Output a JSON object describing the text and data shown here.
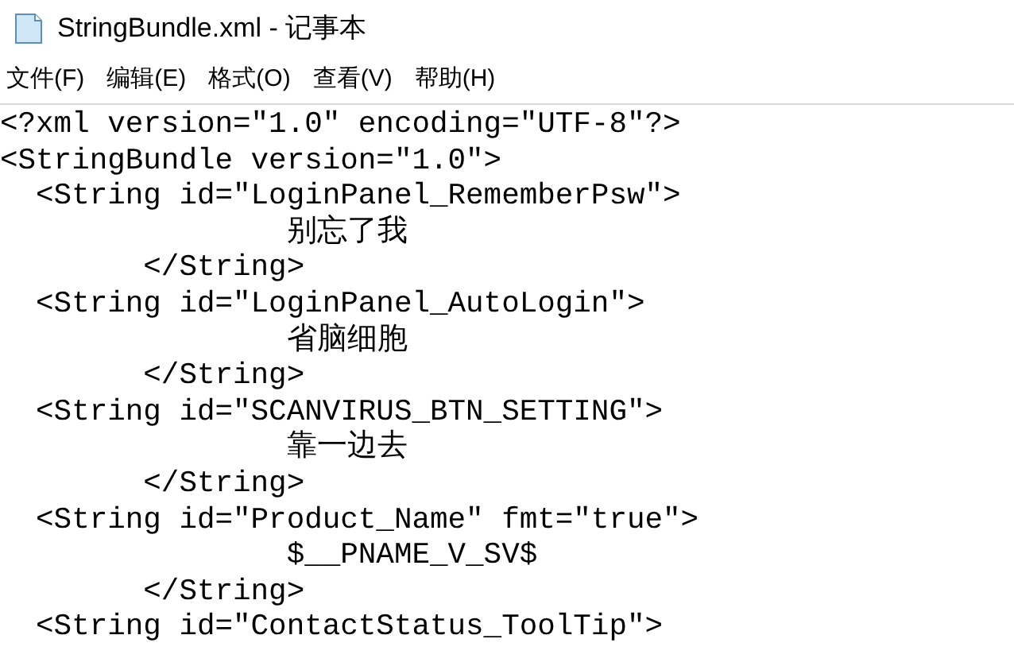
{
  "window": {
    "title": "StringBundle.xml - 记事本"
  },
  "menu": [
    "文件(F)",
    "编辑(E)",
    "格式(O)",
    "查看(V)",
    "帮助(H)"
  ],
  "lines": [
    "<?xml version=\"1.0\" encoding=\"UTF-8\"?>",
    "<StringBundle version=\"1.0\">",
    "  <String id=\"LoginPanel_RememberPsw\">",
    "                别忘了我",
    "        </String>",
    "  <String id=\"LoginPanel_AutoLogin\">",
    "                省脑细胞",
    "        </String>",
    "  <String id=\"SCANVIRUS_BTN_SETTING\">",
    "                靠一边去",
    "        </String>",
    "  <String id=\"Product_Name\" fmt=\"true\">",
    "                $__PNAME_V_SV$",
    "        </String>",
    "  <String id=\"ContactStatus_ToolTip\">"
  ]
}
